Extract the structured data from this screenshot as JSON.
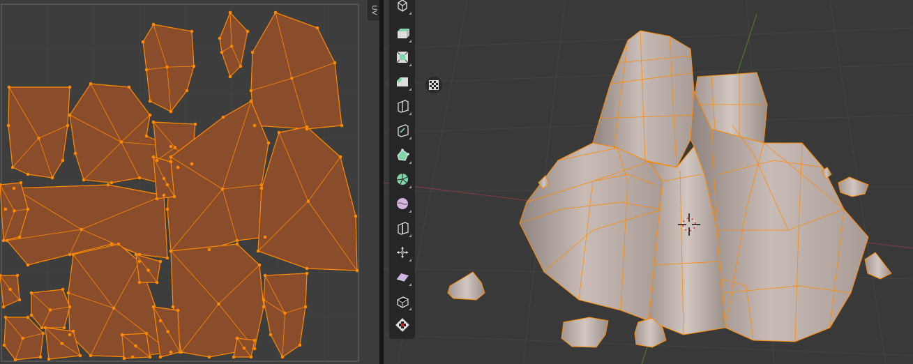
{
  "uv_editor": {
    "tab_label": "UV",
    "colors": {
      "island_fill": "#8a4d2c",
      "edge": "#ff8a00",
      "vertex": "#ff8a00",
      "background": "#3d3d3d",
      "grid": "#474747"
    }
  },
  "viewport": {
    "colors": {
      "background": "#393939",
      "mesh_fill": "#b9aca6",
      "selected_edge": "#ff8a00",
      "x_axis": "#a0414a",
      "y_axis": "#5c8a30"
    },
    "tools": [
      {
        "name": "cursor-select",
        "icon": "cube-select-icon"
      },
      {
        "name": "extrude-region",
        "icon": "extrude-icon"
      },
      {
        "name": "inset-faces",
        "icon": "inset-icon"
      },
      {
        "name": "bevel",
        "icon": "bevel-icon"
      },
      {
        "name": "loop-cut",
        "icon": "loop-cut-icon"
      },
      {
        "name": "knife",
        "icon": "knife-icon"
      },
      {
        "name": "poly-build",
        "icon": "poly-build-icon"
      },
      {
        "name": "spin",
        "icon": "spin-icon"
      },
      {
        "name": "smooth",
        "icon": "smooth-icon"
      },
      {
        "name": "edge-slide",
        "icon": "edge-slide-icon"
      },
      {
        "name": "shrink-fatten",
        "icon": "shrink-fatten-icon"
      },
      {
        "name": "shear",
        "icon": "shear-icon"
      },
      {
        "name": "rip-region",
        "icon": "rip-icon"
      },
      {
        "name": "checker-deselect",
        "icon": "checker-icon"
      }
    ],
    "gizmo": {
      "icon": "checker-grid-icon"
    }
  }
}
